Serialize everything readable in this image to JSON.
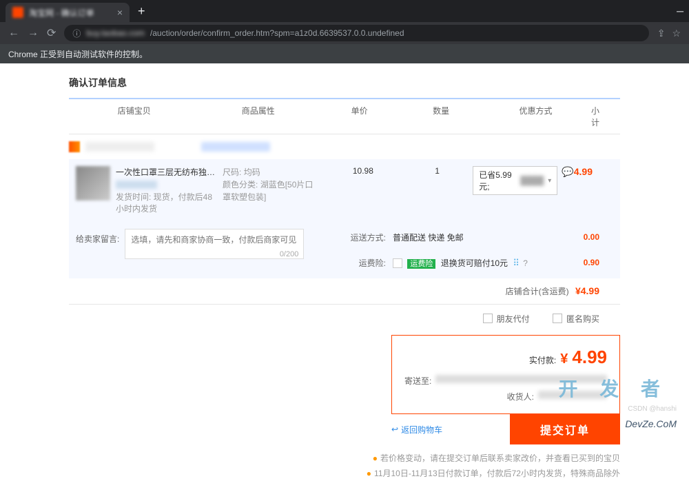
{
  "browser": {
    "tab_title": "淘宝网 - 确认订单",
    "close": "×",
    "newtab": "+",
    "nav": {
      "back": "←",
      "forward": "→",
      "reload": "⟳"
    },
    "url_host": "buy.taobao.com",
    "url_path": "/auction/order/confirm_order.htm?spm=a1z0d.6639537.0.0.undefined",
    "share": "⇪",
    "star": "☆",
    "automation_msg": "Chrome 正受到自动测试软件的控制。"
  },
  "page": {
    "confirm_title": "确认订单信息",
    "headers": {
      "shop": "店铺宝贝",
      "attr": "商品属性",
      "price": "单价",
      "qty": "数量",
      "discount": "优惠方式",
      "subtotal": "小计"
    },
    "product": {
      "title": "一次性口罩三层无纺布独立包装...",
      "ship_note": "发货时间: 现货，付款后48小时内发货",
      "attr_size_label": "尺码:",
      "attr_size_val": "均码",
      "attr_color_label": "颜色分类:",
      "attr_color_val": "湖蓝色[50片口罩软塑包装]",
      "price": "10.98",
      "qty": "1",
      "discount_text": "已省5.99元;",
      "subtotal": "4.99"
    },
    "message": {
      "label": "给卖家留言:",
      "placeholder": "选填，请先和商家协商一致，付款后商家可见",
      "counter": "0/200"
    },
    "shipping": {
      "method_label": "运送方式:",
      "method_val": "普通配送 快递 免邮",
      "method_price": "0.00",
      "insurance_label": "运费险:",
      "insurance_badge": "运费险",
      "insurance_text": "退换货可赔付10元",
      "insurance_price": "0.90"
    },
    "shop_total": {
      "label": "店铺合计(含运费)",
      "value": "¥4.99"
    },
    "checks": {
      "friend_pay": "朋友代付",
      "anonymous": "匿名购买"
    },
    "final": {
      "label": "实付款:",
      "currency": "¥",
      "amount": "4.99",
      "address_label": "寄送至:",
      "receiver_label": "收货人:"
    },
    "actions": {
      "back": "返回购物车",
      "submit": "提交订单"
    },
    "notes": {
      "price_change": "若价格变动，请在提交订单后联系卖家改价，并查看已买到的宝贝",
      "delivery": "11月10日-11月13日付款订单，付款后72小时内发货，特殊商品除外"
    }
  },
  "watermarks": {
    "big": "开 发 者",
    "small": "DevZe.CoM",
    "csdn": "CSDN @hanshi"
  }
}
